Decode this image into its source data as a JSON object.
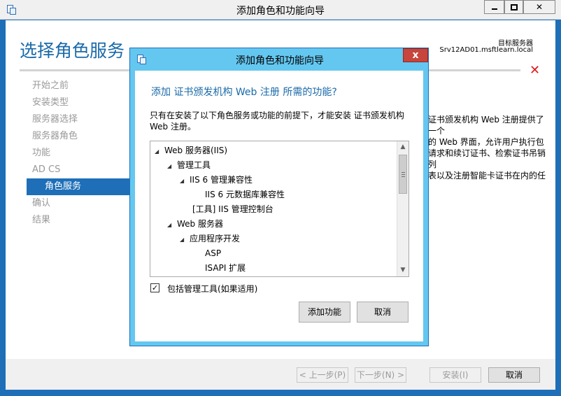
{
  "outer_window": {
    "title": "添加角色和功能向导",
    "min_symbol": "",
    "max_symbol": "",
    "close_symbol": "✕"
  },
  "page": {
    "title": "选择角色服务",
    "target_label": "目标服务器",
    "target_server": "Srv12AD01.msftlearn.local"
  },
  "steps": [
    {
      "label": "开始之前",
      "active": false
    },
    {
      "label": "安装类型",
      "active": false
    },
    {
      "label": "服务器选择",
      "active": false
    },
    {
      "label": "服务器角色",
      "active": false
    },
    {
      "label": "功能",
      "active": false
    },
    {
      "label": "AD CS",
      "active": false
    },
    {
      "label": "角色服务",
      "active": true
    },
    {
      "label": "确认",
      "active": false
    },
    {
      "label": "结果",
      "active": false
    }
  ],
  "description_lines": [
    "证书颁发机构 Web 注册提供了一个",
    "的 Web 界面，允许用户执行包",
    "请求和续订证书、检索证书吊销列",
    "表以及注册智能卡证书在内的任"
  ],
  "footer": {
    "prev": "< 上一步(P)",
    "next": "下一步(N) >",
    "install": "安装(I)",
    "cancel": "取消"
  },
  "dialog": {
    "title": "添加角色和功能向导",
    "close_symbol": "x",
    "heading": "添加 证书颁发机构 Web 注册 所需的功能?",
    "prompt": "只有在安装了以下角色服务或功能的前提下，才能安装 证书颁发机构 Web 注册。",
    "tree_items": [
      {
        "label": "Web 服务器(IIS)",
        "level": 0,
        "expanded": true
      },
      {
        "label": "管理工具",
        "level": 1,
        "expanded": true
      },
      {
        "label": "IIS 6 管理兼容性",
        "level": 2,
        "expanded": true
      },
      {
        "label": "IIS 6 元数据库兼容性",
        "level": 3,
        "expanded": null
      },
      {
        "label": "[工具] IIS 管理控制台",
        "level": 2,
        "expanded": null
      },
      {
        "label": "Web 服务器",
        "level": 1,
        "expanded": true
      },
      {
        "label": "应用程序开发",
        "level": 2,
        "expanded": true
      },
      {
        "label": "ASP",
        "level": 3,
        "expanded": null
      },
      {
        "label": "ISAPI 扩展",
        "level": 3,
        "expanded": null
      }
    ],
    "checkbox_label": "包括管理工具(如果适用)",
    "checkbox_checked": true,
    "add_features_label": "添加功能",
    "cancel_label": "取消"
  },
  "colors": {
    "accent": "#1e6fb8",
    "dialog_frame": "#64c7f0",
    "close_red": "#c7453c",
    "error_red": "#e01919"
  },
  "icons": [
    "app-icon",
    "minimize-icon",
    "maximize-icon",
    "close-icon",
    "error-x-icon",
    "expand-triangle-icon",
    "scroll-up-icon",
    "scroll-down-icon",
    "check-icon"
  ]
}
